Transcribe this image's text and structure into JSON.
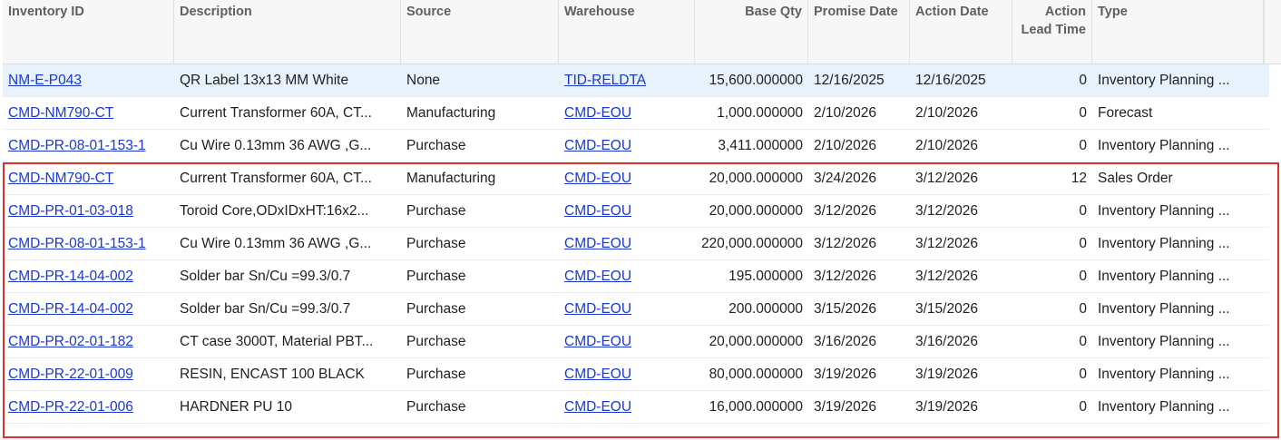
{
  "columns": {
    "inventory_id": "Inventory ID",
    "description": "Description",
    "source": "Source",
    "warehouse": "Warehouse",
    "base_qty": "Base Qty",
    "promise_date": "Promise Date",
    "action_date": "Action Date",
    "action_lead_time": "Action Lead Time",
    "type": "Type"
  },
  "rows": [
    {
      "inventory_id": "NM-E-P043",
      "description": "QR Label 13x13 MM White",
      "source": "None",
      "warehouse": "TID-RELDTA",
      "base_qty": "15,600.000000",
      "promise_date": "12/16/2025",
      "action_date": "12/16/2025",
      "lead_time": "0",
      "type": "Inventory Planning ..."
    },
    {
      "inventory_id": "CMD-NM790-CT",
      "description": "Current Transformer 60A, CT...",
      "source": "Manufacturing",
      "warehouse": "CMD-EOU",
      "base_qty": "1,000.000000",
      "promise_date": "2/10/2026",
      "action_date": "2/10/2026",
      "lead_time": "0",
      "type": "Forecast"
    },
    {
      "inventory_id": "CMD-PR-08-01-153-1",
      "description": "Cu Wire 0.13mm 36 AWG ,G...",
      "source": "Purchase",
      "warehouse": "CMD-EOU",
      "base_qty": "3,411.000000",
      "promise_date": "2/10/2026",
      "action_date": "2/10/2026",
      "lead_time": "0",
      "type": "Inventory Planning ..."
    },
    {
      "inventory_id": "CMD-NM790-CT",
      "description": "Current Transformer 60A, CT...",
      "source": "Manufacturing",
      "warehouse": "CMD-EOU",
      "base_qty": "20,000.000000",
      "promise_date": "3/24/2026",
      "action_date": "3/12/2026",
      "lead_time": "12",
      "type": "Sales Order"
    },
    {
      "inventory_id": "CMD-PR-01-03-018",
      "description": "Toroid Core,ODxIDxHT:16x2...",
      "source": "Purchase",
      "warehouse": "CMD-EOU",
      "base_qty": "20,000.000000",
      "promise_date": "3/12/2026",
      "action_date": "3/12/2026",
      "lead_time": "0",
      "type": "Inventory Planning ..."
    },
    {
      "inventory_id": "CMD-PR-08-01-153-1",
      "description": "Cu Wire 0.13mm 36 AWG ,G...",
      "source": "Purchase",
      "warehouse": "CMD-EOU",
      "base_qty": "220,000.000000",
      "promise_date": "3/12/2026",
      "action_date": "3/12/2026",
      "lead_time": "0",
      "type": "Inventory Planning ..."
    },
    {
      "inventory_id": "CMD-PR-14-04-002",
      "description": "Solder bar Sn/Cu =99.3/0.7",
      "source": "Purchase",
      "warehouse": "CMD-EOU",
      "base_qty": "195.000000",
      "promise_date": "3/12/2026",
      "action_date": "3/12/2026",
      "lead_time": "0",
      "type": "Inventory Planning ..."
    },
    {
      "inventory_id": "CMD-PR-14-04-002",
      "description": "Solder bar Sn/Cu =99.3/0.7",
      "source": "Purchase",
      "warehouse": "CMD-EOU",
      "base_qty": "200.000000",
      "promise_date": "3/15/2026",
      "action_date": "3/15/2026",
      "lead_time": "0",
      "type": "Inventory Planning ..."
    },
    {
      "inventory_id": "CMD-PR-02-01-182",
      "description": "CT case 3000T, Material PBT...",
      "source": "Purchase",
      "warehouse": "CMD-EOU",
      "base_qty": "20,000.000000",
      "promise_date": "3/16/2026",
      "action_date": "3/16/2026",
      "lead_time": "0",
      "type": "Inventory Planning ..."
    },
    {
      "inventory_id": "CMD-PR-22-01-009",
      "description": "RESIN, ENCAST 100 BLACK",
      "source": "Purchase",
      "warehouse": "CMD-EOU",
      "base_qty": "80,000.000000",
      "promise_date": "3/19/2026",
      "action_date": "3/19/2026",
      "lead_time": "0",
      "type": "Inventory Planning ..."
    },
    {
      "inventory_id": "CMD-PR-22-01-006",
      "description": "HARDNER PU 10",
      "source": "Purchase",
      "warehouse": "CMD-EOU",
      "base_qty": "16,000.000000",
      "promise_date": "3/19/2026",
      "action_date": "3/19/2026",
      "lead_time": "0",
      "type": "Inventory Planning ..."
    }
  ],
  "colors": {
    "link": "#1a38c9",
    "selected_row": "#e8f2fc",
    "highlight_border": "#d9312b",
    "header_bg": "#f7f7f7"
  }
}
